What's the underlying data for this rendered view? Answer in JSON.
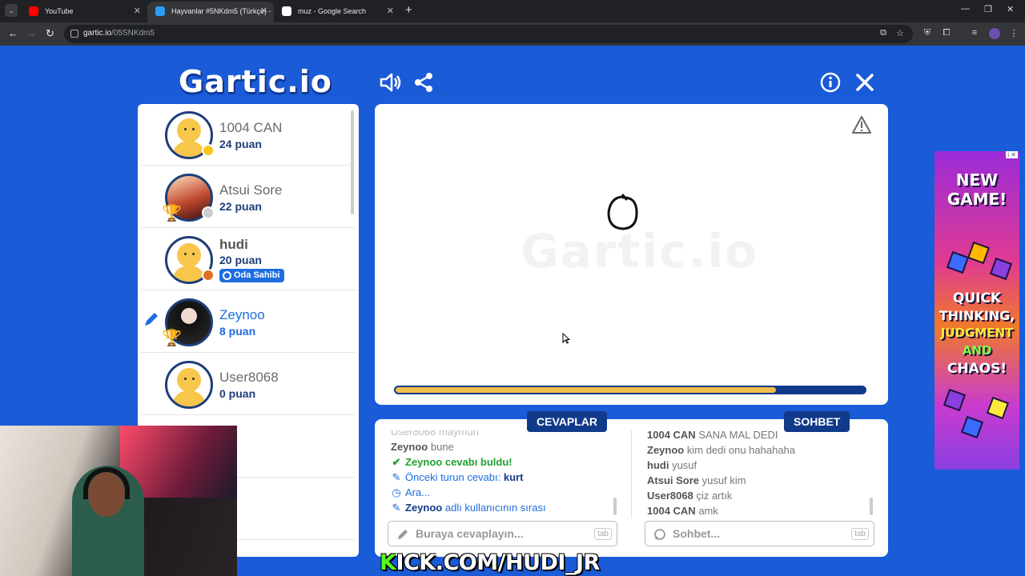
{
  "browser": {
    "tabs": [
      {
        "title": "YouTube",
        "favicon_color": "#ff0000"
      },
      {
        "title": "Hayvanlar #5NKdm5 (Türkçe) -",
        "favicon_color": "#2a9df4"
      },
      {
        "title": "muz - Google Search",
        "favicon_color": "#ffffff"
      }
    ],
    "url_host": "gartic.io",
    "url_path": "/05SNKdm5"
  },
  "header": {
    "logo": "Gartic.io",
    "icons": [
      "sound-icon",
      "share-icon",
      "info-icon",
      "close-icon"
    ]
  },
  "players": [
    {
      "name": "1004 CAN",
      "score": "24 puan",
      "status_color": "#f5c518",
      "avatar": "default"
    },
    {
      "name": "Atsui Sore",
      "score": "22 puan",
      "status_color": "#cccccc",
      "avatar": "photo",
      "trophy": true
    },
    {
      "name": "hudi",
      "score": "20 puan",
      "status_color": "#e07020",
      "avatar": "default",
      "badge": "Oda Sahibi"
    },
    {
      "name": "Zeynoo",
      "score": "8 puan",
      "avatar": "photo",
      "trophy": true,
      "drawing": true
    },
    {
      "name": "User8068",
      "score": "0 puan",
      "avatar": "default"
    }
  ],
  "canvas": {
    "watermark": "Gartic.io",
    "timer_fraction": 0.81
  },
  "answers": {
    "label": "CEVAPLAR",
    "placeholder": "Buraya cevaplayın...",
    "tab_hint": "tab",
    "messages": {
      "m0": "User8068 maymun",
      "m1_user": "Zeynoo",
      "m1_text": "bune",
      "m2": "Zeynoo cevabı buldu!",
      "m3_text": "Önceki turun cevabı:",
      "m3_answer": "kurt",
      "m4": "Ara...",
      "m5_user": "Zeynoo",
      "m5_text": "adlı kullanıcının sırası"
    }
  },
  "chat": {
    "label": "SOHBET",
    "placeholder": "Sohbet...",
    "tab_hint": "tab",
    "messages": [
      {
        "user": "1004 CAN",
        "text": "SANA MAL DEDİ"
      },
      {
        "user": "Zeynoo",
        "text": "kim dedi onu hahahaha"
      },
      {
        "user": "hudi",
        "text": "yusuf"
      },
      {
        "user": "Atsui Sore",
        "text": "yusuf kim"
      },
      {
        "user": "User8068",
        "text": "çiz artık"
      },
      {
        "user": "1004 CAN",
        "text": "amk"
      }
    ]
  },
  "ad": {
    "line1": "NEW",
    "line2": "GAME!",
    "line3": "QUICK",
    "line4": "THINKING,",
    "line5": "JUDGMENT",
    "line6": "AND",
    "line7": "CHAOS!"
  },
  "overlay": {
    "stream_k": "K",
    "stream_rest": "ICK.COM/HUDI_JR"
  }
}
